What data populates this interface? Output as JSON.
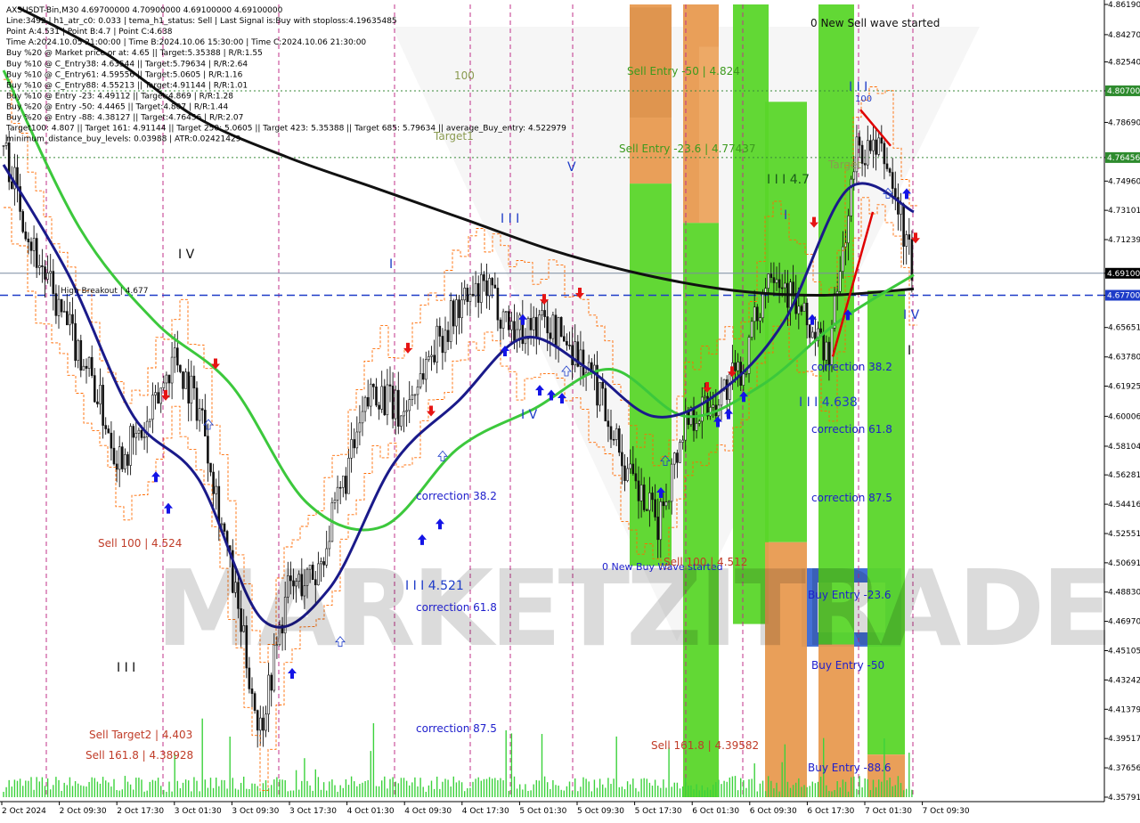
{
  "info": {
    "lines": [
      "AXSUSDT-Bin,M30  4.69700000 4.70900000 4.69100000 4.69100000",
      "Line:3492 | h1_atr_c0: 0.033 | tema_h1_status: Sell | Last Signal is:Buy with stoploss:4.19635485",
      "Point A:4.531 | Point B:4.7 | Point C:4.638",
      "Time A:2024.10.05 21:00:00 | Time B:2024.10.06 15:30:00 | Time C:2024.10.06 21:30:00",
      "Buy %20 @ Market price or at: 4.65 || Target:5.35388 | R/R:1.55",
      "Buy %10 @ C_Entry38: 4.63544 || Target:5.79634 | R/R:2.64",
      "Buy %10 @ C_Entry61: 4.59556 || Target:5.0605 | R/R:1.16",
      "Buy %10 @ C_Entry88: 4.55213 || Target:4.91144 | R/R:1.01",
      "Buy %10 @ Entry -23: 4.49112 || Target:4.869 | R/R:1.28",
      "Buy %20 @ Entry -50: 4.4465 || Target:4.807 | R/R:1.44",
      "Buy %20 @ Entry -88: 4.38127 || Target:4.76456 | R/R:2.07",
      "Target100: 4.807 || Target 161: 4.91144 || Target 250: 5.0605 || Target 423: 5.35388 || Target 685: 5.79634 || average_Buy_entry: 4.522979",
      "minimum_distance_buy_levels: 0.03988 | ATR:0.02421429"
    ]
  },
  "price_axis": {
    "ticks": [
      "4.86190",
      "4.84270",
      "4.82540",
      "4.80700",
      "4.78690",
      "4.76456",
      "4.74960",
      "4.73101",
      "4.71239",
      "4.69100",
      "4.67700",
      "4.65651",
      "4.63780",
      "4.61925",
      "4.60006",
      "4.58104",
      "4.56281",
      "4.54416",
      "4.52551",
      "4.50691",
      "4.48830",
      "4.46970",
      "4.45105",
      "4.43242",
      "4.41379",
      "4.39517",
      "4.37656",
      "4.35791"
    ],
    "highlighted": [
      {
        "value": "4.80700",
        "color": "#2e8b2e"
      },
      {
        "value": "4.76456",
        "color": "#2e8b2e"
      },
      {
        "value": "4.69100",
        "color": "#000000"
      },
      {
        "value": "4.67700",
        "color": "#1e3cc8"
      }
    ]
  },
  "time_axis": {
    "labels": [
      "2 Oct 2024",
      "2 Oct 09:30",
      "2 Oct 17:30",
      "3 Oct 01:30",
      "3 Oct 09:30",
      "3 Oct 17:30",
      "4 Oct 01:30",
      "4 Oct 09:30",
      "4 Oct 17:30",
      "5 Oct 01:30",
      "5 Oct 09:30",
      "5 Oct 17:30",
      "6 Oct 01:30",
      "6 Oct 09:30",
      "6 Oct 17:30",
      "7 Oct 01:30",
      "7 Oct 09:30"
    ]
  },
  "labels": {
    "watermark": "MARKETZITRADE",
    "sell_entry_50": "Sell Entry -50 | 4.824",
    "sell_entry_23": "Sell Entry -23.6 | 4.77437",
    "new_sell_wave": "0 New Sell wave started",
    "new_buy_wave": "0 New Buy Wave started",
    "sell_100_a": "Sell 100 | 4.524",
    "sell_100_b": "Sell 100 | 4.512",
    "sell_target2": "Sell Target2 | 4.403",
    "sell_161_a": "Sell 161.8 | 4.38928",
    "sell_161_b": "Sell 161.8 | 4.39582",
    "high_breakout": "High Breakout | 4.677",
    "label_100": "100",
    "label_100b": "100",
    "target1": "Target1",
    "target_b": "Target",
    "wave_4_7": "I I I 4.7",
    "wave_4_638": "I I I 4.638",
    "wave_4_521": "I I I 4.521",
    "corr_38_a": "correction 38.2",
    "corr_61_a": "correction 61.8",
    "corr_87_a": "correction 87.5",
    "corr_38_b": "correction 38.2",
    "corr_61_b": "correction 61.8",
    "corr_87_b": "correction 87.5",
    "buy_entry_23": "Buy Entry -23.6",
    "buy_entry_50": "Buy Entry -50",
    "buy_entry_88": "Buy Entry -88.6",
    "roman_iv_1": "I V",
    "roman_iv_2": "I V",
    "roman_iv_3": "I V",
    "roman_v_1": "V",
    "roman_iii_1": "I I I",
    "roman_iii_2": "I I I",
    "roman_iii_3": "I I I",
    "roman_i_1": "I",
    "roman_i_2": "I",
    "roman_i_3": "I"
  },
  "chart_data": {
    "type": "candlestick",
    "symbol": "AXSUSDT-Bin",
    "timeframe": "M30",
    "ohlc_last": {
      "open": 4.697,
      "high": 4.709,
      "low": 4.691,
      "close": 4.691
    },
    "y_range": [
      4.3579,
      4.8619
    ],
    "levels": {
      "target100": 4.807,
      "target_small": 4.76456,
      "current_price": 4.691,
      "high_breakout": 4.677
    },
    "close_path": [
      {
        "t": "2 Oct 2024",
        "v": 4.772
      },
      {
        "t": "2 Oct 05:00",
        "v": 4.71
      },
      {
        "t": "2 Oct 09:30",
        "v": 4.665
      },
      {
        "t": "2 Oct 14:00",
        "v": 4.63
      },
      {
        "t": "2 Oct 17:30",
        "v": 4.575
      },
      {
        "t": "2 Oct 22:00",
        "v": 4.59
      },
      {
        "t": "3 Oct 01:30",
        "v": 4.64
      },
      {
        "t": "3 Oct 05:00",
        "v": 4.6
      },
      {
        "t": "3 Oct 09:30",
        "v": 4.5
      },
      {
        "t": "3 Oct 13:00",
        "v": 4.4
      },
      {
        "t": "3 Oct 17:30",
        "v": 4.49
      },
      {
        "t": "3 Oct 22:00",
        "v": 4.5
      },
      {
        "t": "4 Oct 01:30",
        "v": 4.56
      },
      {
        "t": "4 Oct 05:00",
        "v": 4.62
      },
      {
        "t": "4 Oct 09:30",
        "v": 4.6
      },
      {
        "t": "4 Oct 13:00",
        "v": 4.64
      },
      {
        "t": "4 Oct 17:30",
        "v": 4.67
      },
      {
        "t": "4 Oct 22:00",
        "v": 4.68
      },
      {
        "t": "5 Oct 01:30",
        "v": 4.655
      },
      {
        "t": "5 Oct 05:00",
        "v": 4.66
      },
      {
        "t": "5 Oct 09:30",
        "v": 4.645
      },
      {
        "t": "5 Oct 13:00",
        "v": 4.615
      },
      {
        "t": "5 Oct 17:30",
        "v": 4.56
      },
      {
        "t": "5 Oct 21:00",
        "v": 4.531
      },
      {
        "t": "6 Oct 01:30",
        "v": 4.6
      },
      {
        "t": "6 Oct 05:00",
        "v": 4.61
      },
      {
        "t": "6 Oct 09:30",
        "v": 4.63
      },
      {
        "t": "6 Oct 15:30",
        "v": 4.7
      },
      {
        "t": "6 Oct 17:30",
        "v": 4.665
      },
      {
        "t": "6 Oct 21:30",
        "v": 4.638
      },
      {
        "t": "7 Oct 01:30",
        "v": 4.77
      },
      {
        "t": "7 Oct 05:00",
        "v": 4.765
      },
      {
        "t": "7 Oct 09:30",
        "v": 4.691
      }
    ],
    "ema_black": [
      4.86,
      4.83,
      4.79,
      4.765,
      4.745,
      4.725,
      4.705,
      4.69,
      4.68,
      4.677,
      4.681
    ],
    "ema_green": [
      4.82,
      4.72,
      4.66,
      4.62,
      4.545,
      4.53,
      4.58,
      4.605,
      4.63,
      4.6,
      4.62,
      4.66,
      4.69
    ],
    "ema_navy": [
      4.76,
      4.69,
      4.6,
      4.56,
      4.47,
      4.49,
      4.57,
      4.61,
      4.65,
      4.63,
      4.6,
      4.615,
      4.66,
      4.745,
      4.73
    ],
    "zones": {
      "sell_orange": [
        "4.824",
        "4.77437"
      ],
      "buy_green": [
        "4.49112",
        "4.4465",
        "4.38127"
      ]
    },
    "signals": {
      "buy_arrows": 22,
      "sell_arrows": 12
    }
  }
}
